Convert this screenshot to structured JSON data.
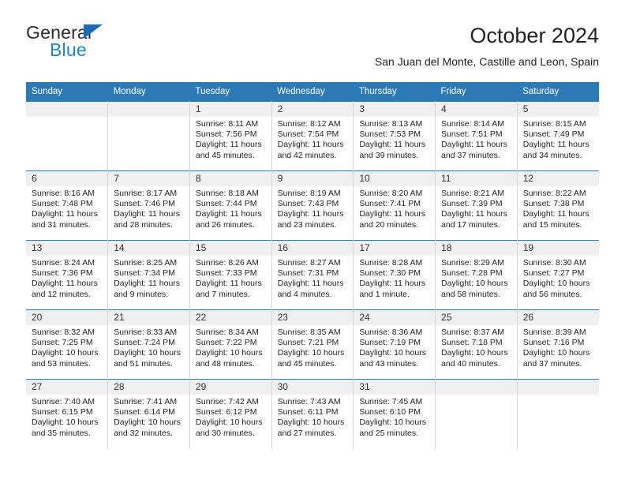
{
  "brand": {
    "name_top": "General",
    "name_bottom": "Blue",
    "triangle_color": "#1b6cb5",
    "blue_color": "#2283d0"
  },
  "header": {
    "title": "October 2024",
    "subtitle": "San Juan del Monte, Castille and Leon, Spain"
  },
  "theme": {
    "header_bg": "#2d7ab8",
    "header_text": "#ffffff",
    "daynum_bg": "#f0f0f0",
    "cell_divider": "#d6d6d6"
  },
  "calendar": {
    "weekday_headers": [
      "Sunday",
      "Monday",
      "Tuesday",
      "Wednesday",
      "Thursday",
      "Friday",
      "Saturday"
    ],
    "weeks": [
      [
        {
          "day": "",
          "sunrise": "",
          "sunset": "",
          "daylight_line1": "",
          "daylight_line2": ""
        },
        {
          "day": "",
          "sunrise": "",
          "sunset": "",
          "daylight_line1": "",
          "daylight_line2": ""
        },
        {
          "day": "1",
          "sunrise": "Sunrise: 8:11 AM",
          "sunset": "Sunset: 7:56 PM",
          "daylight_line1": "Daylight: 11 hours",
          "daylight_line2": "and 45 minutes."
        },
        {
          "day": "2",
          "sunrise": "Sunrise: 8:12 AM",
          "sunset": "Sunset: 7:54 PM",
          "daylight_line1": "Daylight: 11 hours",
          "daylight_line2": "and 42 minutes."
        },
        {
          "day": "3",
          "sunrise": "Sunrise: 8:13 AM",
          "sunset": "Sunset: 7:53 PM",
          "daylight_line1": "Daylight: 11 hours",
          "daylight_line2": "and 39 minutes."
        },
        {
          "day": "4",
          "sunrise": "Sunrise: 8:14 AM",
          "sunset": "Sunset: 7:51 PM",
          "daylight_line1": "Daylight: 11 hours",
          "daylight_line2": "and 37 minutes."
        },
        {
          "day": "5",
          "sunrise": "Sunrise: 8:15 AM",
          "sunset": "Sunset: 7:49 PM",
          "daylight_line1": "Daylight: 11 hours",
          "daylight_line2": "and 34 minutes."
        }
      ],
      [
        {
          "day": "6",
          "sunrise": "Sunrise: 8:16 AM",
          "sunset": "Sunset: 7:48 PM",
          "daylight_line1": "Daylight: 11 hours",
          "daylight_line2": "and 31 minutes."
        },
        {
          "day": "7",
          "sunrise": "Sunrise: 8:17 AM",
          "sunset": "Sunset: 7:46 PM",
          "daylight_line1": "Daylight: 11 hours",
          "daylight_line2": "and 28 minutes."
        },
        {
          "day": "8",
          "sunrise": "Sunrise: 8:18 AM",
          "sunset": "Sunset: 7:44 PM",
          "daylight_line1": "Daylight: 11 hours",
          "daylight_line2": "and 26 minutes."
        },
        {
          "day": "9",
          "sunrise": "Sunrise: 8:19 AM",
          "sunset": "Sunset: 7:43 PM",
          "daylight_line1": "Daylight: 11 hours",
          "daylight_line2": "and 23 minutes."
        },
        {
          "day": "10",
          "sunrise": "Sunrise: 8:20 AM",
          "sunset": "Sunset: 7:41 PM",
          "daylight_line1": "Daylight: 11 hours",
          "daylight_line2": "and 20 minutes."
        },
        {
          "day": "11",
          "sunrise": "Sunrise: 8:21 AM",
          "sunset": "Sunset: 7:39 PM",
          "daylight_line1": "Daylight: 11 hours",
          "daylight_line2": "and 17 minutes."
        },
        {
          "day": "12",
          "sunrise": "Sunrise: 8:22 AM",
          "sunset": "Sunset: 7:38 PM",
          "daylight_line1": "Daylight: 11 hours",
          "daylight_line2": "and 15 minutes."
        }
      ],
      [
        {
          "day": "13",
          "sunrise": "Sunrise: 8:24 AM",
          "sunset": "Sunset: 7:36 PM",
          "daylight_line1": "Daylight: 11 hours",
          "daylight_line2": "and 12 minutes."
        },
        {
          "day": "14",
          "sunrise": "Sunrise: 8:25 AM",
          "sunset": "Sunset: 7:34 PM",
          "daylight_line1": "Daylight: 11 hours",
          "daylight_line2": "and 9 minutes."
        },
        {
          "day": "15",
          "sunrise": "Sunrise: 8:26 AM",
          "sunset": "Sunset: 7:33 PM",
          "daylight_line1": "Daylight: 11 hours",
          "daylight_line2": "and 7 minutes."
        },
        {
          "day": "16",
          "sunrise": "Sunrise: 8:27 AM",
          "sunset": "Sunset: 7:31 PM",
          "daylight_line1": "Daylight: 11 hours",
          "daylight_line2": "and 4 minutes."
        },
        {
          "day": "17",
          "sunrise": "Sunrise: 8:28 AM",
          "sunset": "Sunset: 7:30 PM",
          "daylight_line1": "Daylight: 11 hours",
          "daylight_line2": "and 1 minute."
        },
        {
          "day": "18",
          "sunrise": "Sunrise: 8:29 AM",
          "sunset": "Sunset: 7:28 PM",
          "daylight_line1": "Daylight: 10 hours",
          "daylight_line2": "and 58 minutes."
        },
        {
          "day": "19",
          "sunrise": "Sunrise: 8:30 AM",
          "sunset": "Sunset: 7:27 PM",
          "daylight_line1": "Daylight: 10 hours",
          "daylight_line2": "and 56 minutes."
        }
      ],
      [
        {
          "day": "20",
          "sunrise": "Sunrise: 8:32 AM",
          "sunset": "Sunset: 7:25 PM",
          "daylight_line1": "Daylight: 10 hours",
          "daylight_line2": "and 53 minutes."
        },
        {
          "day": "21",
          "sunrise": "Sunrise: 8:33 AM",
          "sunset": "Sunset: 7:24 PM",
          "daylight_line1": "Daylight: 10 hours",
          "daylight_line2": "and 51 minutes."
        },
        {
          "day": "22",
          "sunrise": "Sunrise: 8:34 AM",
          "sunset": "Sunset: 7:22 PM",
          "daylight_line1": "Daylight: 10 hours",
          "daylight_line2": "and 48 minutes."
        },
        {
          "day": "23",
          "sunrise": "Sunrise: 8:35 AM",
          "sunset": "Sunset: 7:21 PM",
          "daylight_line1": "Daylight: 10 hours",
          "daylight_line2": "and 45 minutes."
        },
        {
          "day": "24",
          "sunrise": "Sunrise: 8:36 AM",
          "sunset": "Sunset: 7:19 PM",
          "daylight_line1": "Daylight: 10 hours",
          "daylight_line2": "and 43 minutes."
        },
        {
          "day": "25",
          "sunrise": "Sunrise: 8:37 AM",
          "sunset": "Sunset: 7:18 PM",
          "daylight_line1": "Daylight: 10 hours",
          "daylight_line2": "and 40 minutes."
        },
        {
          "day": "26",
          "sunrise": "Sunrise: 8:39 AM",
          "sunset": "Sunset: 7:16 PM",
          "daylight_line1": "Daylight: 10 hours",
          "daylight_line2": "and 37 minutes."
        }
      ],
      [
        {
          "day": "27",
          "sunrise": "Sunrise: 7:40 AM",
          "sunset": "Sunset: 6:15 PM",
          "daylight_line1": "Daylight: 10 hours",
          "daylight_line2": "and 35 minutes."
        },
        {
          "day": "28",
          "sunrise": "Sunrise: 7:41 AM",
          "sunset": "Sunset: 6:14 PM",
          "daylight_line1": "Daylight: 10 hours",
          "daylight_line2": "and 32 minutes."
        },
        {
          "day": "29",
          "sunrise": "Sunrise: 7:42 AM",
          "sunset": "Sunset: 6:12 PM",
          "daylight_line1": "Daylight: 10 hours",
          "daylight_line2": "and 30 minutes."
        },
        {
          "day": "30",
          "sunrise": "Sunrise: 7:43 AM",
          "sunset": "Sunset: 6:11 PM",
          "daylight_line1": "Daylight: 10 hours",
          "daylight_line2": "and 27 minutes."
        },
        {
          "day": "31",
          "sunrise": "Sunrise: 7:45 AM",
          "sunset": "Sunset: 6:10 PM",
          "daylight_line1": "Daylight: 10 hours",
          "daylight_line2": "and 25 minutes."
        },
        {
          "day": "",
          "sunrise": "",
          "sunset": "",
          "daylight_line1": "",
          "daylight_line2": ""
        },
        {
          "day": "",
          "sunrise": "",
          "sunset": "",
          "daylight_line1": "",
          "daylight_line2": ""
        }
      ]
    ]
  }
}
